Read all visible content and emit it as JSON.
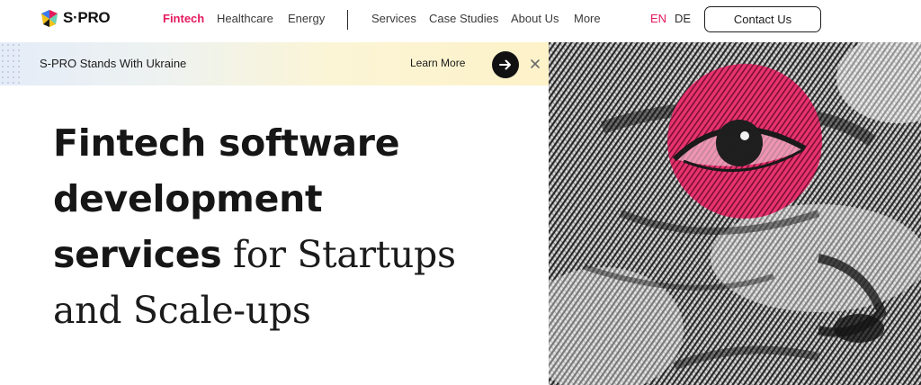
{
  "header": {
    "logo_text": "S·PRO",
    "nav": [
      {
        "label": "Fintech",
        "active": true
      },
      {
        "label": "Healthcare",
        "active": false
      },
      {
        "label": "Energy",
        "active": false
      },
      {
        "label": "Services",
        "active": false
      },
      {
        "label": "Case Studies",
        "active": false
      },
      {
        "label": "About Us",
        "active": false
      },
      {
        "label": "More",
        "active": false
      }
    ],
    "languages": [
      {
        "label": "EN",
        "active": true
      },
      {
        "label": "DE",
        "active": false
      }
    ],
    "contact_label": "Contact Us"
  },
  "banner": {
    "text": "S-PRO Stands With Ukraine",
    "learn_more": "Learn More"
  },
  "hero": {
    "line1": "Fintech software",
    "line2": "development",
    "line3_bold": "services",
    "line3_rest": " for Startups",
    "line4": "and Scale-ups"
  },
  "colors": {
    "accent": "#e5195f",
    "text": "#1b1b1b",
    "eye_circle": "#e8336e"
  }
}
